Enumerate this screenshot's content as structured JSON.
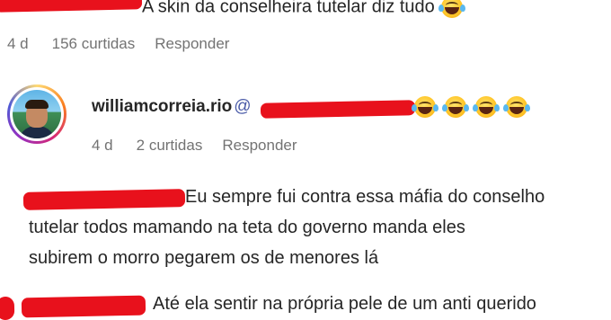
{
  "comment1": {
    "text": "A skin da conselheira tutelar diz tudo",
    "age": "4 d",
    "likes": "156 curtidas",
    "reply": "Responder"
  },
  "comment2": {
    "username": "williamcorreia.rio",
    "mention_prefix": "@",
    "age": "4 d",
    "likes": "2 curtidas",
    "reply": "Responder",
    "emoji": "rolling-on-floor-laughing-icon"
  },
  "comment3": {
    "line1": "Eu sempre fui contra essa máfia do conselho",
    "line2": "tutelar todos mamando na teta do governo manda eles",
    "line3": "subirem o morro pegarem os de menores lá"
  },
  "comment4": {
    "text": "Até ela sentir na própria pele de um anti querido"
  },
  "colors": {
    "redaction": "#e8111c",
    "meta_text": "#737373",
    "mention": "#4a5ba8"
  }
}
